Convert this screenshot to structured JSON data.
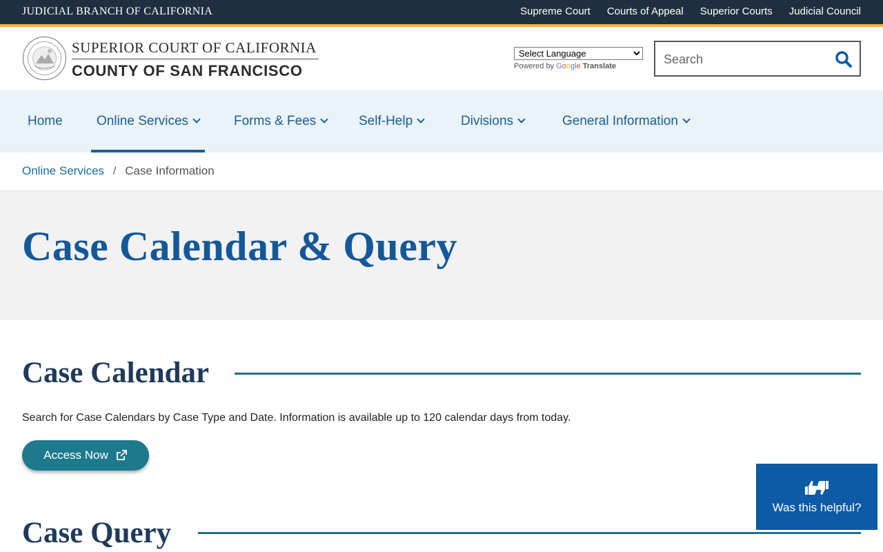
{
  "topbar": {
    "title": "JUDICIAL BRANCH OF CALIFORNIA",
    "links": [
      "Supreme Court",
      "Courts of Appeal",
      "Superior Courts",
      "Judicial Council"
    ]
  },
  "header": {
    "court_line1": "SUPERIOR COURT OF CALIFORNIA",
    "court_line2": "COUNTY OF SAN FRANCISCO",
    "language_select": "Select Language",
    "powered_by": "Powered by",
    "google": [
      "G",
      "o",
      "o",
      "g",
      "l",
      "e"
    ],
    "translate": "Translate",
    "search_placeholder": "Search"
  },
  "nav": {
    "items": [
      {
        "label": "Home"
      },
      {
        "label": "Online Services"
      },
      {
        "label": "Forms & Fees"
      },
      {
        "label": "Self-Help"
      },
      {
        "label": "Divisions"
      },
      {
        "label": "General Information"
      }
    ]
  },
  "breadcrumb": {
    "parent": "Online Services",
    "separator": "/",
    "current": "Case Information"
  },
  "hero": {
    "title": "Case Calendar & Query"
  },
  "case_calendar": {
    "title": "Case Calendar",
    "description": "Search for Case Calendars by Case Type and Date. Information is available up to 120 calendar days from today.",
    "button": "Access Now"
  },
  "case_query": {
    "title": "Case Query"
  },
  "feedback": {
    "label": "Was this helpful?"
  },
  "colors": {
    "topbar": "#1f2f3f",
    "accent": "#f3b72b",
    "nav_bg": "#eaf2fa",
    "link": "#1a5f94",
    "title": "#15589a",
    "button": "#1d7a8c",
    "feedback": "#0d5aa6"
  },
  "icons": [
    "court-seal-icon",
    "search-icon",
    "chevron-down-icon",
    "external-link-icon",
    "thumbs-up-down-icon"
  ]
}
